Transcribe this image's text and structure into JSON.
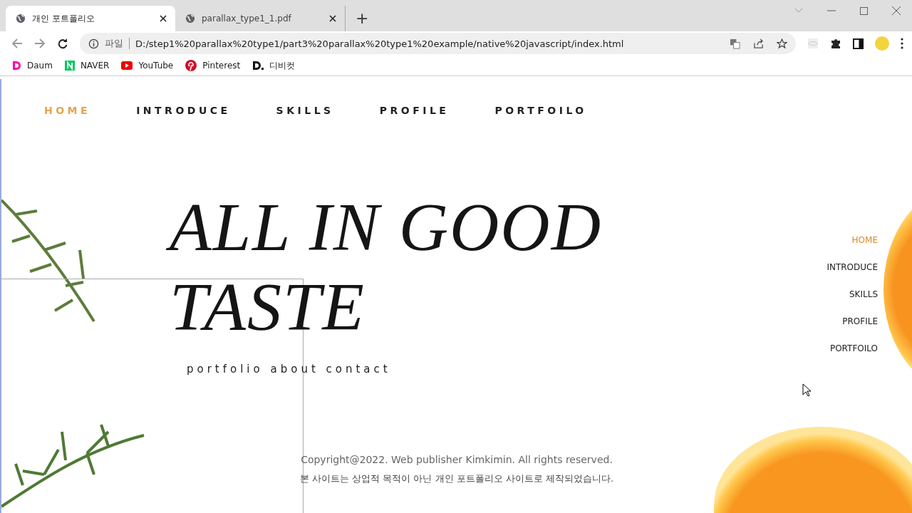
{
  "browser": {
    "tabs": [
      {
        "title": "개인 포트폴리오",
        "selected": true
      },
      {
        "title": "parallax_type1_1.pdf",
        "selected": false
      }
    ],
    "new_tab": "+",
    "address": {
      "scheme": "파일",
      "url": "D:/step1%20parallax%20type1/part3%20parallax%20type1%20example/native%20javascript/index.html"
    },
    "bookmarks": [
      {
        "label": "Daum",
        "kind": "daum"
      },
      {
        "label": "NAVER",
        "kind": "naver"
      },
      {
        "label": "YouTube",
        "kind": "youtube"
      },
      {
        "label": "Pinterest",
        "kind": "pinterest"
      },
      {
        "label": "디비컷",
        "kind": "dbcut"
      }
    ]
  },
  "page": {
    "nav": [
      {
        "label": "HOME",
        "selected": true
      },
      {
        "label": "INTRODUCE",
        "selected": false
      },
      {
        "label": "SKILLS",
        "selected": false
      },
      {
        "label": "PROFILE",
        "selected": false
      },
      {
        "label": "PORTFOILO",
        "selected": false
      }
    ],
    "hero": {
      "title_lines": [
        "ALL IN GOOD",
        "TASTE"
      ],
      "subtitle": "portfolio about contact"
    },
    "side_nav": [
      {
        "label": "HOME",
        "selected": true
      },
      {
        "label": "INTRODUCE",
        "selected": false
      },
      {
        "label": "SKILLS",
        "selected": false
      },
      {
        "label": "PROFILE",
        "selected": false
      },
      {
        "label": "PORTFOILO",
        "selected": false
      }
    ],
    "footer": {
      "copyright": "Copyright@2022. Web publisher Kimkimin. All rights reserved.",
      "notice": "본 사이트는 상업적 목적이 아닌 개인 포트폴리오 사이트로 제작되었습니다."
    }
  }
}
